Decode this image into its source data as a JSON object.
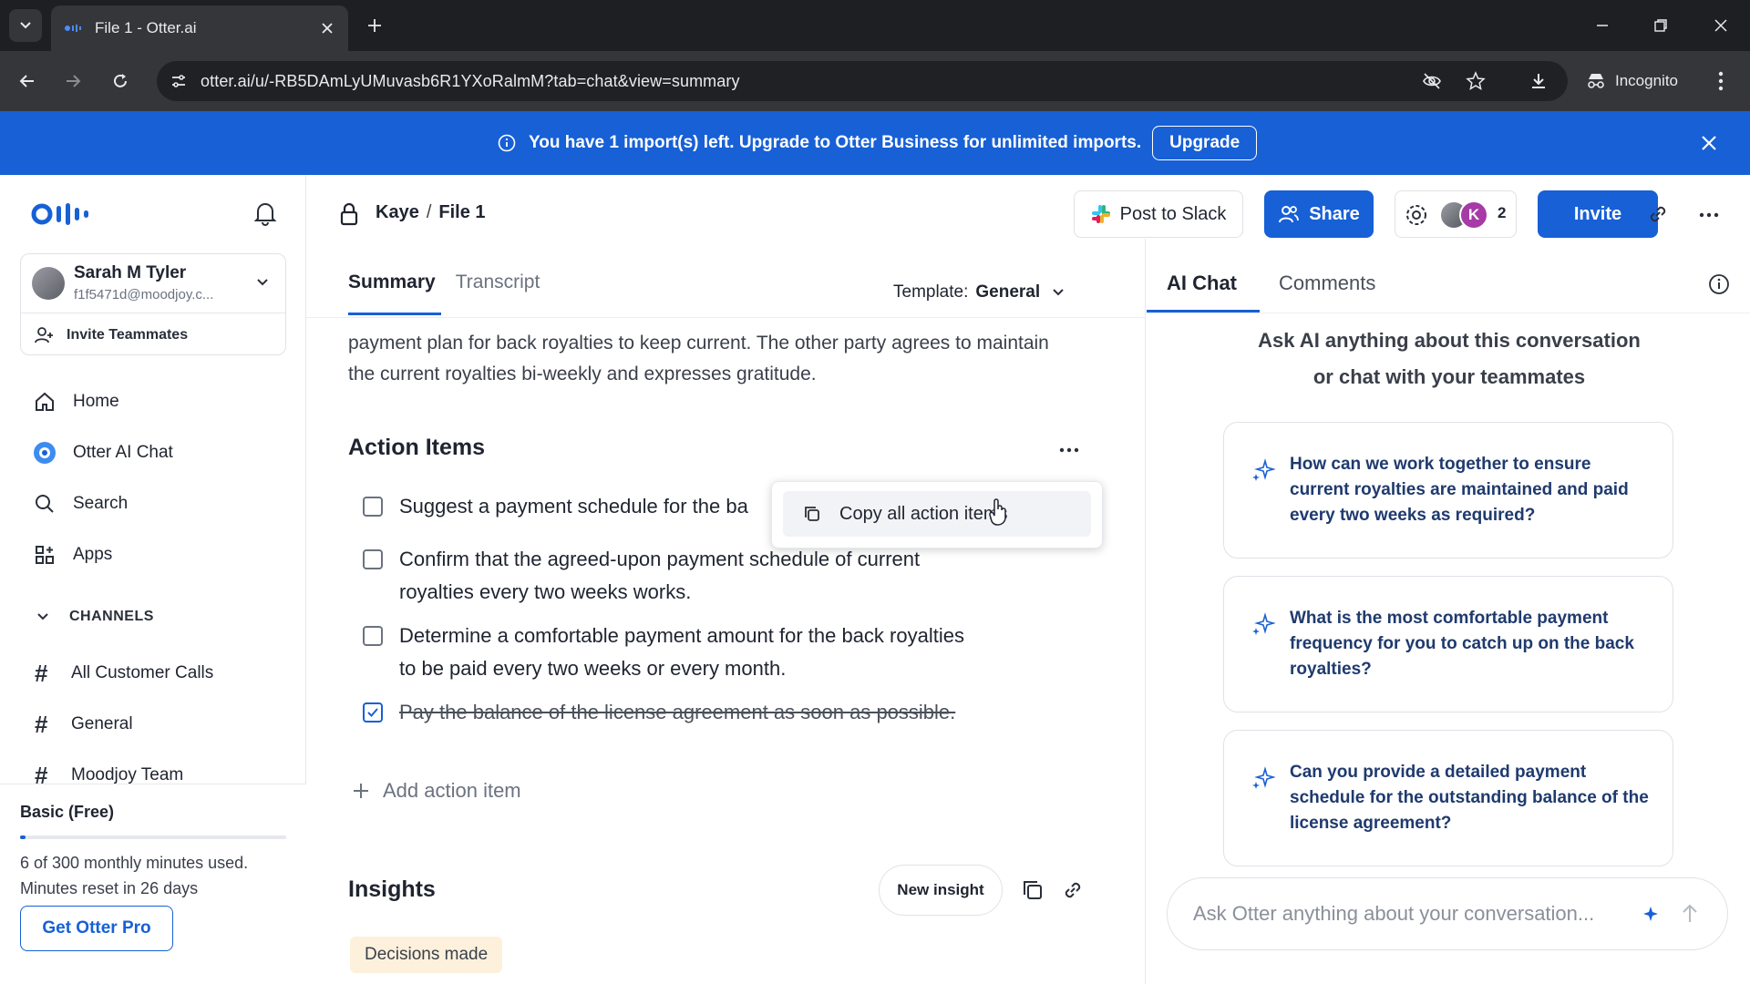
{
  "browser": {
    "tab_title": "File 1 - Otter.ai",
    "url": "otter.ai/u/-RB5DAmLyUMuvasb6R1YXoRalmM?tab=chat&view=summary",
    "incognito_label": "Incognito"
  },
  "banner": {
    "message": "You have 1 import(s) left. Upgrade to Otter Business for unlimited imports.",
    "upgrade_label": "Upgrade"
  },
  "sidebar": {
    "user": {
      "name": "Sarah M Tyler",
      "email": "f1f5471d@moodjoy.c..."
    },
    "invite_teammates": "Invite Teammates",
    "nav": [
      {
        "label": "Home",
        "icon": "home-icon"
      },
      {
        "label": "Otter AI Chat",
        "icon": "otter-ai-chat-icon"
      },
      {
        "label": "Search",
        "icon": "search-icon"
      },
      {
        "label": "Apps",
        "icon": "apps-icon"
      }
    ],
    "channels_label": "CHANNELS",
    "channels": [
      "All Customer Calls",
      "General",
      "Moodjoy Team"
    ],
    "plan": {
      "name": "Basic (Free)",
      "usage": "6 of 300 monthly minutes used.",
      "reset": "Minutes reset in 26 days",
      "used_fraction": 0.02,
      "cta": "Get Otter Pro"
    }
  },
  "header": {
    "breadcrumb_workspace": "Kaye",
    "breadcrumb_sep": "/",
    "breadcrumb_file": "File 1",
    "post_to_slack": "Post to Slack",
    "share": "Share",
    "avatar_initial": "K",
    "participants_count": "2",
    "invite": "Invite"
  },
  "main": {
    "tabs": [
      "Summary",
      "Transcript"
    ],
    "template_label": "Template:",
    "template_value": "General",
    "summary_text": "payment plan for back royalties to keep current. The other party agrees to maintain the current royalties bi-weekly and expresses gratitude.",
    "action_items_title": "Action Items",
    "action_items": [
      {
        "text": "Suggest a payment schedule for the ba",
        "checked": false
      },
      {
        "text": "Confirm that the agreed-upon payment schedule of current royalties every two weeks works.",
        "checked": false
      },
      {
        "text": "Determine a comfortable payment amount for the back royalties to be paid every two weeks or every month.",
        "checked": false
      },
      {
        "text": "Pay the balance of the license agreement as soon as possible.",
        "checked": true
      }
    ],
    "add_action_item": "Add action item",
    "menu_copy_all": "Copy all action items",
    "insights_title": "Insights",
    "new_insight": "New insight",
    "insight_tag": "Decisions made"
  },
  "right_panel": {
    "tabs": [
      "AI Chat",
      "Comments"
    ],
    "intro_line1": "Ask AI anything about this conversation",
    "intro_line2": "or chat with your teammates",
    "suggestions": [
      "How can we work together to ensure current royalties are maintained and paid every two weeks as required?",
      "What is the most comfortable payment frequency for you to catch up on the back royalties?",
      "Can you provide a detailed payment schedule for the outstanding balance of the license agreement?"
    ],
    "input_placeholder": "Ask Otter anything about your conversation..."
  },
  "colors": {
    "brand_blue": "#1760d6",
    "chrome_dark": "#35363a",
    "insight_tag_bg": "#fdf1dc"
  }
}
